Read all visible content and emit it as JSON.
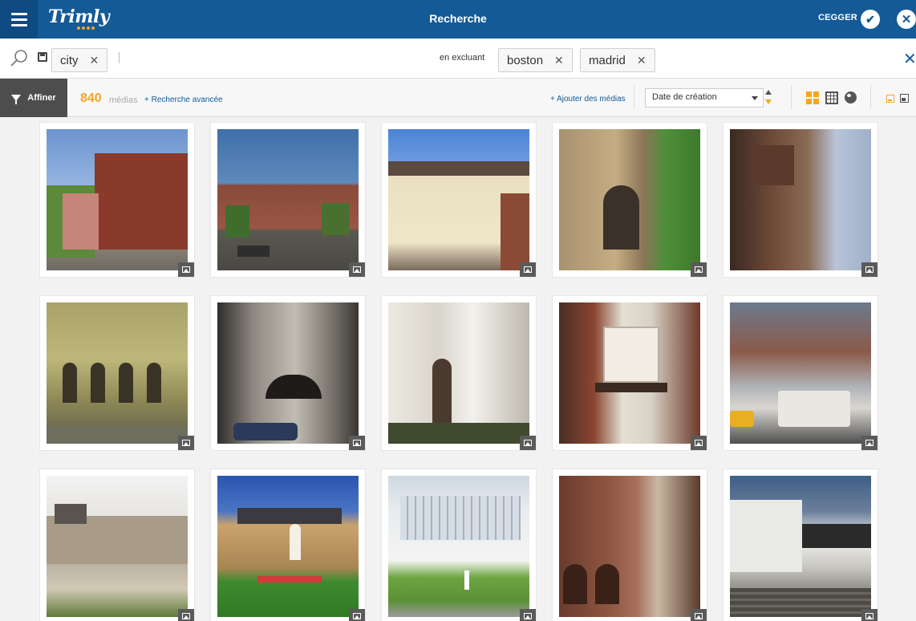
{
  "header": {
    "logo": "Trimly",
    "title": "Recherche",
    "user": "CEGGER"
  },
  "search": {
    "include_tags": [
      "city"
    ],
    "exclude_label": "en excluant",
    "exclude_tags": [
      "boston",
      "madrid"
    ]
  },
  "toolbar": {
    "refine_label": "Affiner",
    "count": "840",
    "count_unit": "médias",
    "advanced_link": "+ Recherche avancée",
    "add_media_link": "+ Ajouter des médias",
    "sort_value": "Date de création"
  },
  "colors": {
    "brand": "#135a97",
    "accent": "#f5a623"
  },
  "media": [
    {
      "type": "image",
      "scene": "brick-town-hall"
    },
    {
      "type": "image",
      "scene": "brick-storefront-street"
    },
    {
      "type": "image",
      "scene": "cream-pub-building"
    },
    {
      "type": "image",
      "scene": "gothic-stone-gate"
    },
    {
      "type": "image",
      "scene": "brick-highrise-trees"
    },
    {
      "type": "image",
      "scene": "classical-facade"
    },
    {
      "type": "image",
      "scene": "stone-building-awning"
    },
    {
      "type": "image",
      "scene": "townhouse-row"
    },
    {
      "type": "image",
      "scene": "brick-bay-window"
    },
    {
      "type": "image",
      "scene": "street-traffic-highrise"
    },
    {
      "type": "image",
      "scene": "chateau-courtyard"
    },
    {
      "type": "image",
      "scene": "brick-mansion-lawn"
    },
    {
      "type": "image",
      "scene": "modern-white-building"
    },
    {
      "type": "image",
      "scene": "old-brick-alley"
    },
    {
      "type": "image",
      "scene": "modern-concrete-plaza"
    }
  ]
}
